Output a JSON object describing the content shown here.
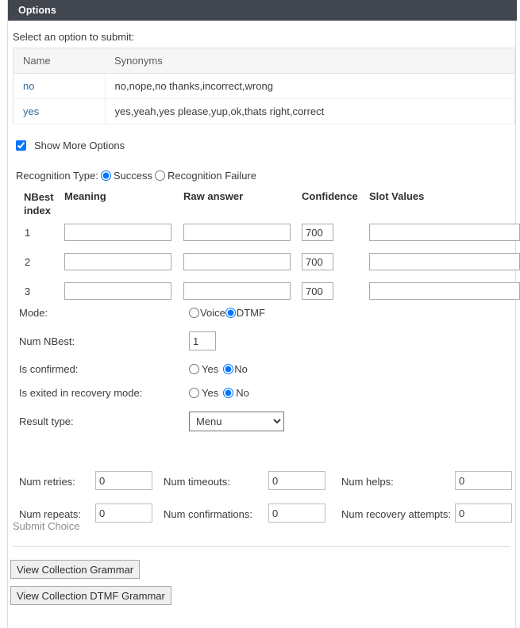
{
  "panel": {
    "title": "Options"
  },
  "options_section": {
    "instruction": "Select an option to submit:",
    "table": {
      "columns": [
        "Name",
        "Synonyms"
      ],
      "rows": [
        {
          "name": "no",
          "synonyms": "no,nope,no thanks,incorrect,wrong"
        },
        {
          "name": "yes",
          "synonyms": "yes,yeah,yes please,yup,ok,thats right,correct"
        }
      ]
    },
    "show_more": {
      "label": "Show More Options",
      "checked": true
    }
  },
  "recognition_type": {
    "label": "Recognition Type:",
    "options": [
      {
        "label": "Success",
        "selected": true
      },
      {
        "label": "Recognition Failure",
        "selected": false
      }
    ]
  },
  "nbest": {
    "headers": {
      "index": "NBest index",
      "index_line1": "NBest",
      "index_line2": "index",
      "meaning": "Meaning",
      "raw_answer": "Raw answer",
      "confidence": "Confidence",
      "slot_values": "Slot Values"
    },
    "rows": [
      {
        "index": "1",
        "meaning": "",
        "raw_answer": "",
        "confidence": "700",
        "slot_values": ""
      },
      {
        "index": "2",
        "meaning": "",
        "raw_answer": "",
        "confidence": "700",
        "slot_values": ""
      },
      {
        "index": "3",
        "meaning": "",
        "raw_answer": "",
        "confidence": "700",
        "slot_values": ""
      }
    ]
  },
  "settings": {
    "mode": {
      "label": "Mode:",
      "options": [
        {
          "label": "Voice",
          "selected": false
        },
        {
          "label": "DTMF",
          "selected": true
        }
      ]
    },
    "num_nbest": {
      "label": "Num NBest:",
      "value": "1"
    },
    "is_confirmed": {
      "label": "Is confirmed:",
      "options": [
        {
          "label": "Yes",
          "selected": false
        },
        {
          "label": "No",
          "selected": true
        }
      ]
    },
    "is_exited_recovery": {
      "label": "Is exited in recovery mode:",
      "options": [
        {
          "label": "Yes",
          "selected": false
        },
        {
          "label": "No",
          "selected": true
        }
      ]
    },
    "result_type": {
      "label": "Result type:",
      "value": "Menu",
      "options": [
        "Menu"
      ]
    }
  },
  "counters": {
    "num_retries": {
      "label": "Num retries:",
      "value": "0"
    },
    "num_timeouts": {
      "label": "Num timeouts:",
      "value": "0"
    },
    "num_helps": {
      "label": "Num helps:",
      "value": "0"
    },
    "num_repeats": {
      "label": "Num repeats:",
      "value": "0"
    },
    "num_confirmations": {
      "label": "Num confirmations:",
      "value": "0"
    },
    "num_recovery_attempts": {
      "label": "Num recovery attempts:",
      "value": "0"
    }
  },
  "actions": {
    "submit_choice": "Submit Choice",
    "view_collection_grammar": "View Collection Grammar",
    "view_collection_dtmf_grammar": "View Collection DTMF Grammar"
  }
}
